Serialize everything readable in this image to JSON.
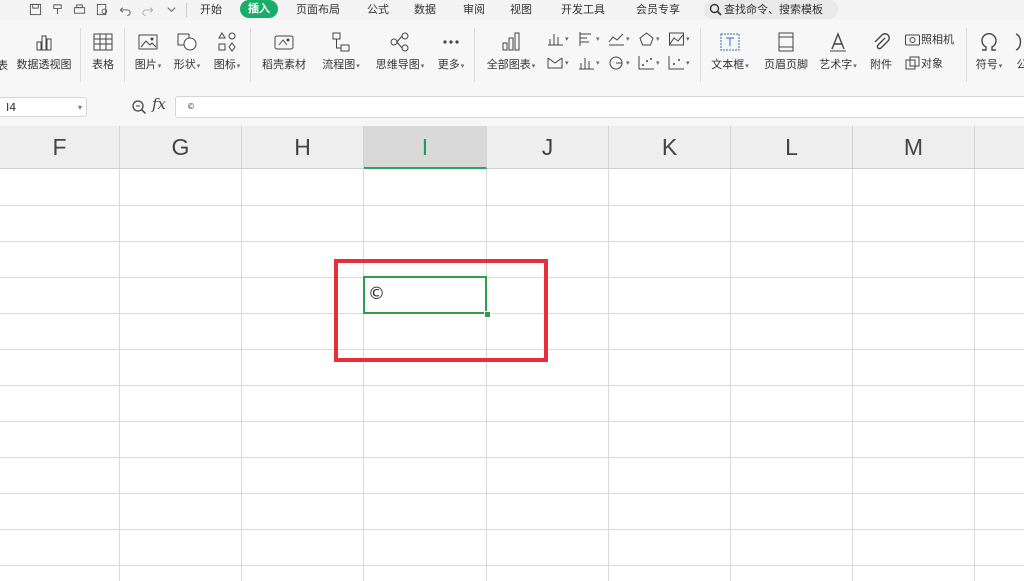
{
  "toolbar_tabs": {
    "start": "开始",
    "insert": "插入",
    "page_layout": "页面布局",
    "formula": "公式",
    "data": "数据",
    "review": "审阅",
    "view": "视图",
    "developer": "开发工具",
    "member": "会员专享"
  },
  "search": {
    "label": "查找命令、搜索模板"
  },
  "ribbon": {
    "cut_label": "表",
    "pivot_chart": "数据透视图",
    "table": "表格",
    "picture": "图片",
    "shape": "形状",
    "icon": "图标",
    "daoke": "稻壳素材",
    "flowchart": "流程图",
    "mindmap": "思维导图",
    "more": "更多",
    "all_charts": "全部图表",
    "textbox": "文本框",
    "header_footer": "页眉页脚",
    "wordart": "艺术字",
    "attachment": "附件",
    "camera": "照相机",
    "object": "对象",
    "symbol": "符号",
    "formula_cut": "公"
  },
  "formula_bar": {
    "name_box": "I4",
    "fx": "fx",
    "content": "©"
  },
  "columns": [
    "F",
    "G",
    "H",
    "I",
    "J",
    "K",
    "L",
    "M"
  ],
  "selected_column": "I",
  "active_cell": {
    "ref": "I4",
    "value": "©"
  },
  "colors": {
    "accent": "#1aac6a",
    "selection": "#2e9e4a",
    "highlight": "#e5303a"
  }
}
